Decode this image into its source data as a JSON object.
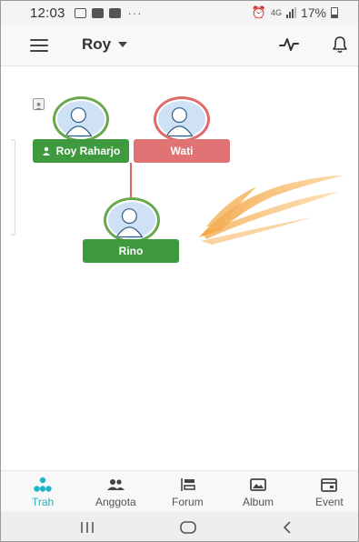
{
  "status_bar": {
    "time": "12:03",
    "overflow": "···",
    "network": "4G",
    "battery": "17%"
  },
  "app_bar": {
    "title": "Roy"
  },
  "tree": {
    "members": [
      {
        "name": "Roy Raharjo",
        "gender": "male"
      },
      {
        "name": "Wati",
        "gender": "female"
      },
      {
        "name": "Rino",
        "gender": "male"
      }
    ]
  },
  "bottom_nav": {
    "items": [
      {
        "label": "Trah",
        "icon": "family-tree-icon",
        "active": true
      },
      {
        "label": "Anggota",
        "icon": "members-icon",
        "active": false
      },
      {
        "label": "Forum",
        "icon": "forum-icon",
        "active": false
      },
      {
        "label": "Album",
        "icon": "album-icon",
        "active": false
      },
      {
        "label": "Event",
        "icon": "event-icon",
        "active": false
      }
    ]
  },
  "colors": {
    "male": "#3f9a3f",
    "female": "#e07474",
    "accent": "#1fb5c7"
  }
}
